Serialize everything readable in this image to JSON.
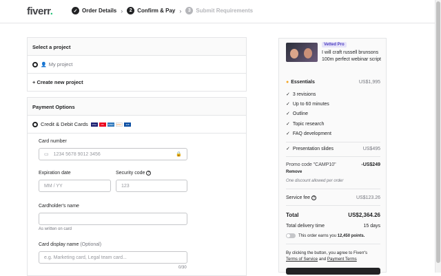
{
  "brand": {
    "name": "fiverr",
    "dot": "."
  },
  "steps": [
    {
      "num": "✓",
      "label": "Order Details"
    },
    {
      "num": "2",
      "label": "Confirm & Pay"
    },
    {
      "num": "3",
      "label": "Submit Requirements"
    }
  ],
  "project": {
    "heading": "Select a project",
    "option": "My project",
    "create": "+ Create new project"
  },
  "payment": {
    "heading": "Payment Options",
    "method": "Credit & Debit Cards",
    "cards": [
      "VISA",
      "MC",
      "AMEX",
      "DISC",
      "JCB"
    ],
    "card_number": {
      "label": "Card number",
      "placeholder": "1234 5678 9012 3456"
    },
    "expiration": {
      "label": "Expiration date",
      "placeholder": "MM / YY"
    },
    "security": {
      "label": "Security code",
      "placeholder": "123"
    },
    "holder": {
      "label": "Cardholder's name",
      "hint": "As written on card"
    },
    "display": {
      "label": "Card display name",
      "optional": "(Optional)",
      "placeholder": "e.g. Marketing card, Legal team card...",
      "counter": "0/30"
    }
  },
  "summary": {
    "badge": "Vetted Pro",
    "gig_title": "I will craft russell brunsons 100m perfect webinar script",
    "package": "Essentials",
    "package_price": "US$1,995",
    "features": [
      "3 revisions",
      "Up to 60 minutes",
      "Outline",
      "Topic research",
      "FAQ development"
    ],
    "extra": {
      "label": "Presentation slides",
      "price": "US$495"
    },
    "promo": {
      "label": "Promo code \"CAMP10\"",
      "amount": "-US$249",
      "remove": "Remove",
      "note": "One discount allowed per order"
    },
    "service_fee": {
      "label": "Service fee",
      "amount": "US$123.26"
    },
    "total": {
      "label": "Total",
      "amount": "US$2,364.26"
    },
    "delivery": {
      "label": "Total delivery time",
      "value": "15 days"
    },
    "points": {
      "prefix": "This order earns you",
      "value": "12,450 points."
    },
    "agree": {
      "text": "By clicking the button, you agree to Fiverr's",
      "tos": "Terms of Service",
      "and": "and",
      "payment_terms": "Payment Terms"
    }
  }
}
